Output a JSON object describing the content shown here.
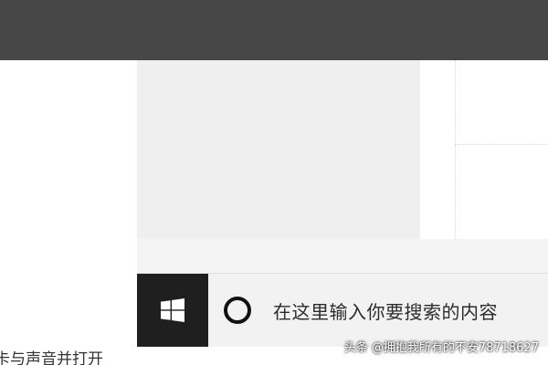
{
  "taskbar": {
    "start_button": {
      "icon": "windows-logo-icon"
    },
    "search": {
      "icon": "cortana-circle-icon",
      "placeholder": "在这里输入你要搜索的内容"
    }
  },
  "caption": {
    "text": "卡与声音并打开"
  },
  "watermark": {
    "text": "头条 @拥抱我所有的不安78718627"
  },
  "colors": {
    "top_bar": "#474747",
    "content_grey": "#efefef",
    "start_button_bg": "#1f1f1f",
    "search_bg": "#f2f2f2"
  }
}
